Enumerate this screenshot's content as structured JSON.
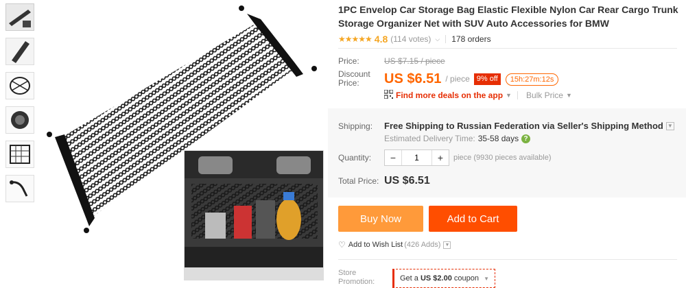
{
  "product": {
    "title": "1PC Envelop Car Storage Bag Elastic Flexible Nylon Car Rear Cargo Trunk Storage Organizer Net with SUV Auto Accessories for BMW",
    "stars": "★★★★★",
    "rating": "4.8",
    "votes": "(114 votes)",
    "orders": "178 orders"
  },
  "price": {
    "label": "Price:",
    "original": "US $7.15 / piece",
    "discount_label_1": "Discount",
    "discount_label_2": "Price:",
    "current": "US $6.51",
    "per": "/ piece",
    "off_badge": "9% off",
    "timer": "15h:27m:12s"
  },
  "deals": {
    "link": "Find more deals on the app",
    "bulk": "Bulk Price"
  },
  "shipping": {
    "label": "Shipping:",
    "text": "Free Shipping to Russian Federation via Seller's Shipping Method",
    "delivery_label": "Estimated Delivery Time:",
    "delivery_days": "35-58 days"
  },
  "quantity": {
    "label": "Quantity:",
    "minus": "−",
    "value": "1",
    "plus": "+",
    "available": "piece (9930 pieces available)"
  },
  "total": {
    "label": "Total Price:",
    "value": "US $6.51"
  },
  "actions": {
    "buy_now": "Buy Now",
    "add_to_cart": "Add to Cart",
    "wish": "Add to Wish List",
    "wish_count": "(426 Adds)"
  },
  "promotion": {
    "label_1": "Store",
    "label_2": "Promotion:",
    "coupon_prefix": "Get a ",
    "coupon_amount": "US $2.00",
    "coupon_suffix": " coupon"
  },
  "colors": {
    "price_orange": "#ff6600",
    "badge_red": "#e62e04",
    "buy_now_bg": "#ff9a3a",
    "cart_bg": "#ff4e00",
    "star": "#f5a623"
  },
  "icons": [
    "heart-icon",
    "qr-code-icon",
    "chevron-down-icon",
    "question-icon"
  ]
}
